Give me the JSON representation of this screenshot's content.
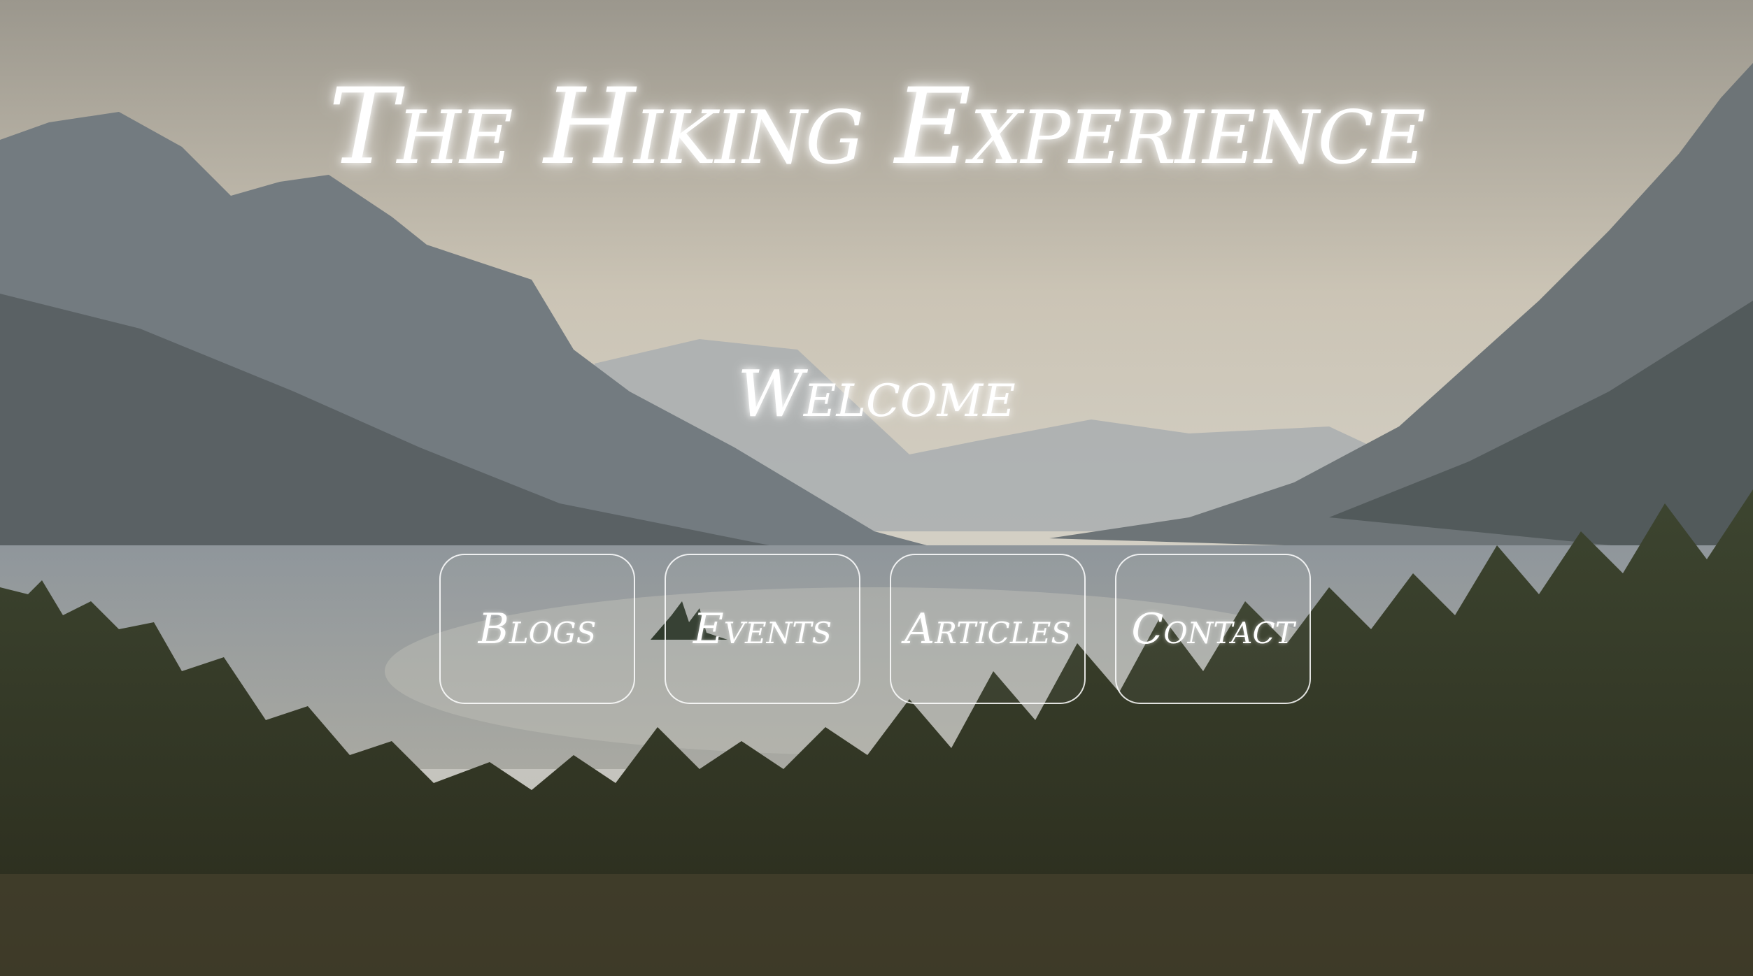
{
  "header": {
    "title": "The Hiking Experience"
  },
  "main": {
    "welcome": "Welcome"
  },
  "nav": {
    "items": [
      {
        "label": "Blogs"
      },
      {
        "label": "Events"
      },
      {
        "label": "Articles"
      },
      {
        "label": "Contact"
      }
    ]
  }
}
